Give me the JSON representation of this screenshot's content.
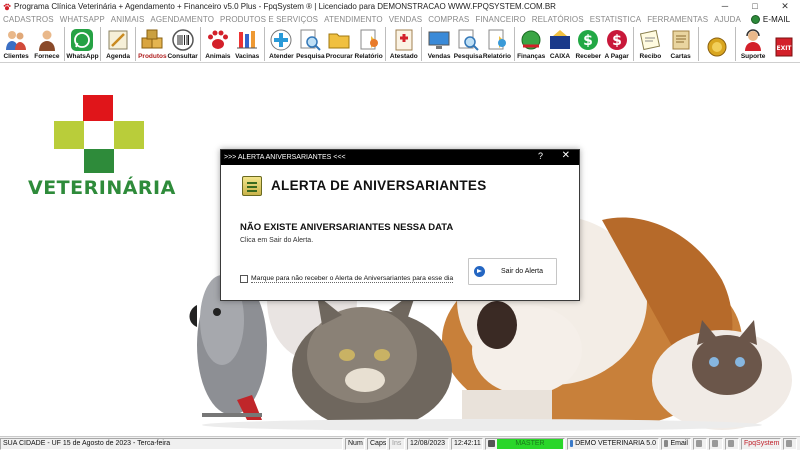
{
  "window": {
    "title": "Programa Clínica Veterinária + Agendamento + Financeiro v5.0 Plus - FpqSystem ® | Licenciado para  DEMONSTRACAO WWW.FPQSYSTEM.COM.BR",
    "minimize": "─",
    "maximize": "□",
    "close": "✕"
  },
  "menu": {
    "items": [
      "CADASTROS",
      "WHATSAPP",
      "ANIMAIS",
      "AGENDAMENTO",
      "PRODUTOS E SERVIÇOS",
      "ATENDIMENTO",
      "VENDAS",
      "COMPRAS",
      "FINANCEIRO",
      "RELATÓRIOS",
      "ESTATISTICA",
      "FERRAMENTAS",
      "AJUDA"
    ],
    "email": "E-MAIL"
  },
  "toolbar": {
    "clientes": "Clientes",
    "fornece": "Fornece",
    "whatsapp": "WhatsApp",
    "agenda": "Agenda",
    "produtos": "Produtos",
    "consultar": "Consultar",
    "animais": "Animais",
    "vacinas": "Vacinas",
    "atender": "Atender",
    "pesquisa1": "Pesquisa",
    "procurar": "Procurar",
    "relatorio1": "Relatório",
    "atestado": "Atestado",
    "vendas": "Vendas",
    "pesquisa2": "Pesquisa",
    "relatorio2": "Relatório",
    "financas": "Finanças",
    "caixa": "CAIXA",
    "receber": "Receber",
    "apagar": "A Pagar",
    "recibo": "Recibo",
    "cartas": "Cartas",
    "suporte": "Suporte"
  },
  "logo": {
    "text": "VETERINÁRIA"
  },
  "dialog": {
    "title": ">>> ALERTA ANIVERSARIANTES <<<",
    "help": "?",
    "close": "✕",
    "heading": "ALERTA DE ANIVERSARIANTES",
    "message": "NÃO EXISTE ANIVERSARIANTES NESSA DATA",
    "hint": "Clica em Sair do Alerta.",
    "checkbox_label": "Marque para não receber o Alerta de Aniversariantes para esse dia",
    "checkbox_checked": false,
    "button_label": "Sair do Alerta"
  },
  "statusbar": {
    "location": "SUA CIDADE - UF 15 de Agosto de 2023 - Terca-feira",
    "num": "Num",
    "caps": "Caps",
    "ins": "Ins",
    "date": "12/08/2023",
    "time": "12:42:11",
    "master": "MASTER",
    "company": "DEMO VETERINARIA 5.0",
    "email": "Email",
    "brand": "FpqSystem"
  },
  "colors": {
    "logo_red": "#e0151a",
    "logo_lime": "#b9cd3a",
    "logo_green": "#2e8b3a",
    "master_green": "#2ad62a",
    "dialog_titlebar": "#000000"
  }
}
